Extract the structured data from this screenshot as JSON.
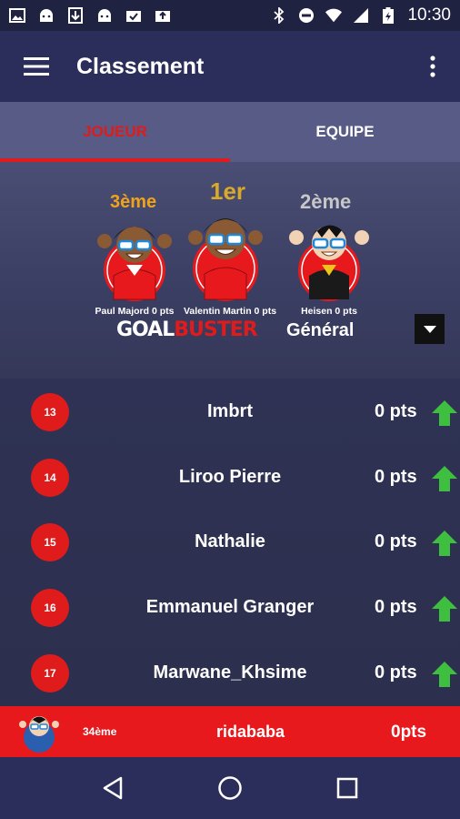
{
  "status_bar": {
    "time": "10:30"
  },
  "app_bar": {
    "title": "Classement"
  },
  "tabs": [
    {
      "label": "JOUEUR",
      "active": true
    },
    {
      "label": "EQUIPE",
      "active": false
    }
  ],
  "podium": {
    "third": {
      "rank": "3ème",
      "name": "Paul Majord 0 pts",
      "color": "#f0a21b"
    },
    "first": {
      "rank": "1er",
      "name": "Valentin Martin 0 pts",
      "color": "#d9a92a"
    },
    "second": {
      "rank": "2ème",
      "name": "Heisen 0 pts",
      "color": "#c7c7c7"
    },
    "logo": {
      "part1": "GOAL",
      "part2": "BUSTER"
    },
    "filter": "Général"
  },
  "rows": [
    {
      "rank": "13",
      "name": "Imbrt",
      "points": "0 pts"
    },
    {
      "rank": "14",
      "name": "Liroo Pierre",
      "points": "0 pts"
    },
    {
      "rank": "15",
      "name": "Nathalie",
      "points": "0 pts"
    },
    {
      "rank": "16",
      "name": "Emmanuel Granger",
      "points": "0 pts"
    },
    {
      "rank": "17",
      "name": "Marwane_Khsime",
      "points": "0 pts"
    }
  ],
  "me": {
    "rank": "34ème",
    "name": "ridababa",
    "points": "0pts"
  },
  "colors": {
    "accent": "#e01b1b",
    "trend_up": "#3fbf3f"
  }
}
